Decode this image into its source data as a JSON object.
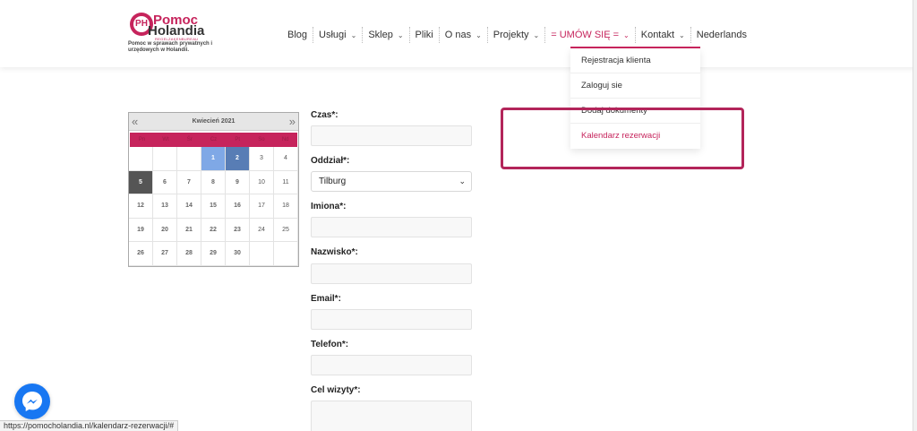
{
  "logo": {
    "mark_letters": "PH",
    "name_line1": "Pomoc",
    "name_line2": "Holandia",
    "subtitle": "REGELZAKENBUREAU",
    "tagline": "Pomoc w sprawach prywatnych i urzędowych w Holandii."
  },
  "nav": {
    "items": [
      {
        "label": "Blog"
      },
      {
        "label": "Usługi"
      },
      {
        "label": "Sklep"
      },
      {
        "label": "Pliki"
      },
      {
        "label": "O nas"
      },
      {
        "label": "Projekty"
      },
      {
        "label": "= UMÓW SIĘ ="
      },
      {
        "label": "Kontakt"
      },
      {
        "label": "Nederlands"
      }
    ],
    "dropdown": [
      {
        "label": "Rejestracja klienta"
      },
      {
        "label": "Zaloguj sie"
      },
      {
        "label": "Dodaj dokumenty"
      },
      {
        "label": "Kalendarz rezerwacji"
      }
    ]
  },
  "calendar": {
    "prev": "«",
    "next": "»",
    "title": "Kwiecień 2021",
    "weekdays": [
      "Pn",
      "Wt",
      "Śr",
      "Cz",
      "Pt",
      "So",
      "Nd"
    ],
    "weeks": [
      [
        "",
        "",
        "",
        "1",
        "2",
        "3",
        "4"
      ],
      [
        "5",
        "6",
        "7",
        "8",
        "9",
        "10",
        "11"
      ],
      [
        "12",
        "13",
        "14",
        "15",
        "16",
        "17",
        "18"
      ],
      [
        "19",
        "20",
        "21",
        "22",
        "23",
        "24",
        "25"
      ],
      [
        "26",
        "27",
        "28",
        "29",
        "30",
        "",
        ""
      ]
    ]
  },
  "form": {
    "time_label": "Czas*:",
    "branch_label": "Oddział*:",
    "branch_value": "Tilburg",
    "firstname_label": "Imiona*:",
    "lastname_label": "Nazwisko*:",
    "email_label": "Email*:",
    "phone_label": "Telefon*:",
    "purpose_label": "Cel wizyty*:"
  },
  "status_bar": {
    "url": "https://pomocholandia.nl/kalendarz-rezerwacji/#"
  },
  "colors": {
    "brand": "#c6245c",
    "highlight": "#b3255a",
    "messenger": "#1877f2"
  }
}
